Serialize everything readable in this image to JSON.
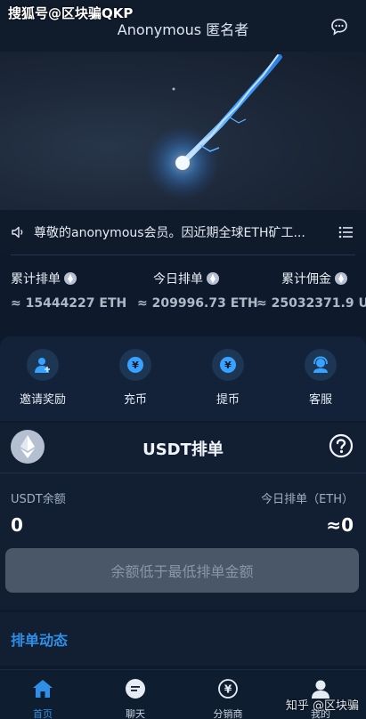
{
  "watermark": "搜狐号@区块骗QKP",
  "header": {
    "title": "Anonymous 匿名者"
  },
  "notice": {
    "text": "尊敬的anonymous会员。因近期全球ETH矿工..."
  },
  "stats": [
    {
      "label": "累计排单",
      "value": "≈ 15444227 ETH"
    },
    {
      "label": "今日排单",
      "value": "≈ 209996.73 ETH"
    },
    {
      "label": "累计佣金",
      "value": "≈ 25032371.9 U"
    }
  ],
  "actions": [
    {
      "label": "邀请奖励",
      "icon": "invite-user-icon"
    },
    {
      "label": "充币",
      "icon": "deposit-coin-icon"
    },
    {
      "label": "提币",
      "icon": "withdraw-coin-icon"
    },
    {
      "label": "客服",
      "icon": "customer-service-icon"
    }
  ],
  "card": {
    "title": "USDT排单",
    "balance_label": "USDT余额",
    "balance_value": "0",
    "today_label": "今日排单（ETH）",
    "today_value": "≈0",
    "button_label": "余额低于最低排单金额"
  },
  "dynamics": {
    "label": "排单动态"
  },
  "tabs": [
    {
      "label": "首页",
      "icon": "home-icon",
      "active": true
    },
    {
      "label": "聊天",
      "icon": "chat-icon",
      "active": false
    },
    {
      "label": "分销商",
      "icon": "distributor-icon",
      "active": false
    },
    {
      "label": "我的",
      "icon": "profile-icon",
      "active": false
    }
  ],
  "corner_watermark": "知乎 @区块骗",
  "colors": {
    "accent": "#2f8fe6",
    "background": "#0e1a2b",
    "disabled_button": "#4a5769"
  }
}
